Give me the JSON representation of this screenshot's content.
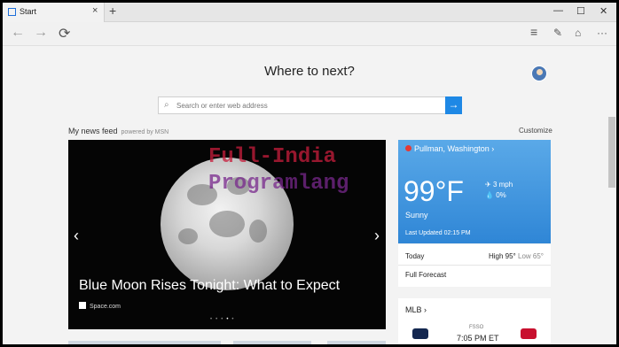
{
  "tab": {
    "label": "Start",
    "close": "×"
  },
  "tabbar": {
    "new_tab": "+",
    "minimize": "—",
    "maximize": "☐",
    "close": "✕"
  },
  "nav": {
    "back": "←",
    "forward": "→",
    "refresh": "⟳",
    "hub": "≡",
    "note": "✎",
    "share": "⌂",
    "more": "···"
  },
  "page": {
    "title": "Where to next?",
    "search_placeholder": "Search or enter web address",
    "feed_title": "My news feed",
    "feed_powered": "powered by MSN",
    "customize": "Customize"
  },
  "hero": {
    "headline": "Blue Moon Rises Tonight: What to Expect",
    "source": "Space.com",
    "dots": "•••",
    "dot_active": "•",
    "dot_last": "•"
  },
  "watermark": {
    "line1": "Full-India",
    "line2": "Programlang"
  },
  "weather": {
    "location": "Pullman, Washington",
    "temp": "99°F",
    "wind": "3 mph",
    "precip": "0%",
    "condition": "Sunny",
    "updated": "Last Updated 02:15 PM"
  },
  "today": {
    "label": "Today",
    "high": "High 95°",
    "low": "Low 65°",
    "full": "Full Forecast"
  },
  "mlb": {
    "label": "MLB",
    "network": "FSSO",
    "time": "7:05 PM ET"
  },
  "colors": {
    "accent": "#1e88e5",
    "weather_top": "#5aa9e8",
    "weather_bottom": "#2f86d6"
  }
}
